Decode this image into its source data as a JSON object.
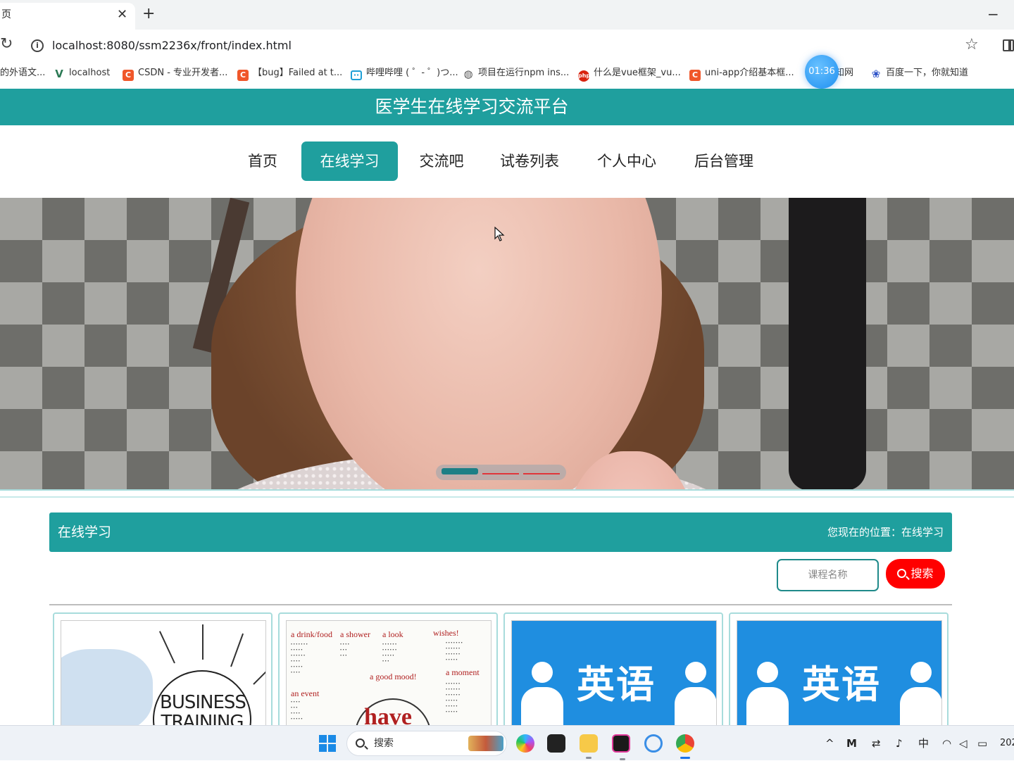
{
  "browser": {
    "tab_title": "页",
    "tab_close": "✕",
    "new_tab": "+",
    "window_minimize": "−",
    "url": "localhost:8080/ssm2236x/front/index.html",
    "bookmarks": [
      {
        "label": "的外语文...",
        "icon": "none"
      },
      {
        "label": "localhost",
        "icon": "vue-icon"
      },
      {
        "label": "CSDN - 专业开发者...",
        "icon": "csdn-icon"
      },
      {
        "label": "【bug】Failed at t...",
        "icon": "csdn-icon"
      },
      {
        "label": "哔哩哔哩 ( ゜- ゜)つ...",
        "icon": "bilibili-icon"
      },
      {
        "label": "项目在运行npm ins...",
        "icon": "globe-icon"
      },
      {
        "label": "什么是vue框架_vu...",
        "icon": "red-icon"
      },
      {
        "label": "uni-app介绍基本框...",
        "icon": "csdn-icon"
      },
      {
        "label": "知网",
        "icon": "none"
      },
      {
        "label": "百度一下，你就知道",
        "icon": "baidu-icon"
      }
    ],
    "timer": "01:36"
  },
  "site": {
    "title": "医学生在线学习交流平台",
    "nav": [
      {
        "label": "首页",
        "active": false
      },
      {
        "label": "在线学习",
        "active": true
      },
      {
        "label": "交流吧",
        "active": false
      },
      {
        "label": "试卷列表",
        "active": false
      },
      {
        "label": "个人中心",
        "active": false
      },
      {
        "label": "后台管理",
        "active": false
      }
    ]
  },
  "banner": {
    "slides_total": 3,
    "active_slide": 1
  },
  "section": {
    "title": "在线学习",
    "breadcrumb": "您现在的位置：在线学习"
  },
  "search": {
    "placeholder": "课程名称",
    "button_label": "搜索"
  },
  "cards": [
    {
      "image": "business-training",
      "image_text": "BUSINESS TRAINING"
    },
    {
      "image": "have-vocabulary",
      "image_text": "have"
    },
    {
      "image": "english-title",
      "image_text": "英语"
    },
    {
      "image": "english-title",
      "image_text": "英语"
    }
  ],
  "have_image": {
    "headings": [
      "a drink/food",
      "a shower",
      "a look",
      "wishes!",
      "an event",
      "a good mood!",
      "a moment"
    ]
  },
  "taskbar": {
    "search_label": "搜索",
    "tray_ime": "中",
    "tray_clock": "202"
  },
  "colors": {
    "brand_teal": "#1f9f9e",
    "search_red": "#ff0000"
  }
}
